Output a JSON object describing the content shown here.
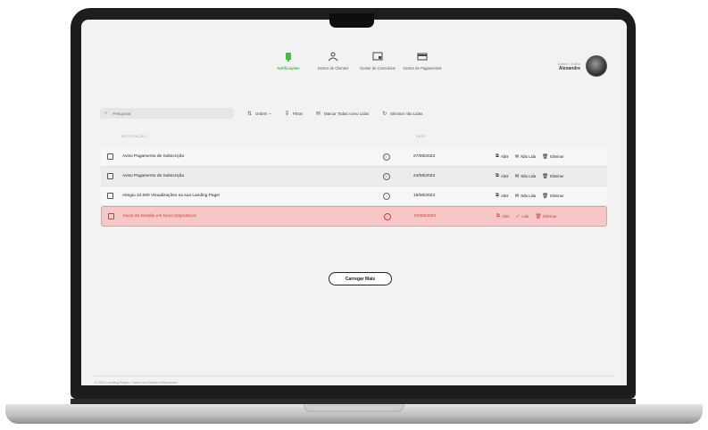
{
  "nav": {
    "items": [
      {
        "label": "Notificações",
        "active": true,
        "icon": "bell-icon"
      },
      {
        "label": "Gestor de Clientes",
        "active": false,
        "icon": "users-icon"
      },
      {
        "label": "Gestor de Conteúdos",
        "active": false,
        "icon": "content-icon"
      },
      {
        "label": "Gestor de Pagamentos",
        "active": false,
        "icon": "card-icon"
      }
    ]
  },
  "user": {
    "role": "Admin / Editor",
    "name": "Alexandre"
  },
  "toolbar": {
    "search_placeholder": "Pesquisar",
    "sort_label": "Ordem",
    "filter_label": "Filtrar",
    "mark_all_label": "Marcar Todas como Lidas",
    "delete_read_label": "Eliminar não Lidas"
  },
  "table": {
    "col_notification": "NOTIFICAÇÃO ↓",
    "col_date": "DATA ↓",
    "rows": [
      {
        "text": "Aviso Pagamento de Subscrição",
        "date": "27/08/2023",
        "actions": [
          "Abrir",
          "Não Lida",
          "Eliminar"
        ]
      },
      {
        "text": "Aviso Pagamento de Subscrição",
        "date": "24/08/2023",
        "actions": [
          "Abrir",
          "Não Lida",
          "Eliminar"
        ]
      },
      {
        "text": "Atingiu 10.000 Visualizações na sua Landing Page!",
        "date": "15/08/2023",
        "actions": [
          "Abrir",
          "Não Lida",
          "Eliminar"
        ]
      },
      {
        "text": "Início de Sessão em Novo Dispositivo!",
        "date": "07/08/2023",
        "actions": [
          "Abrir",
          "Lida",
          "Eliminar"
        ]
      }
    ]
  },
  "load_more": "Carregar Mais",
  "footer": "© 2023 Landing Pages • Todos os Direitos Reservados",
  "colors": {
    "accent": "#3dbf3d",
    "alert": "#d43a3a",
    "alert_bg": "#f7c6c6"
  }
}
